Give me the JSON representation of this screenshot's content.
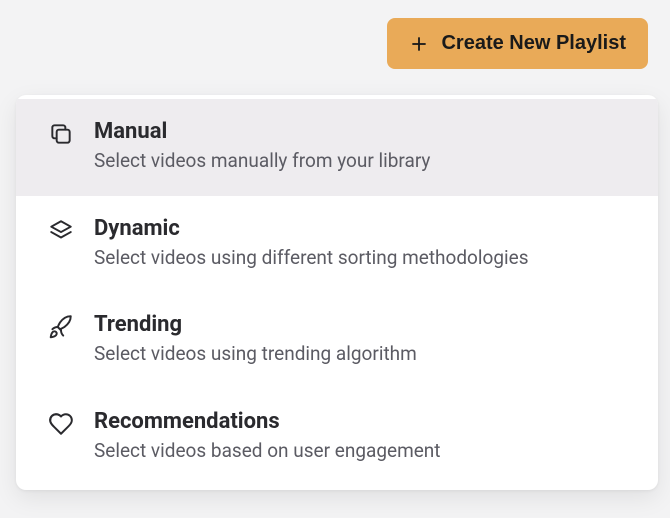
{
  "header": {
    "create_button": "Create New Playlist"
  },
  "menu": {
    "items": [
      {
        "title": "Manual",
        "description": "Select videos manually from your library"
      },
      {
        "title": "Dynamic",
        "description": "Select videos using different sorting methodologies"
      },
      {
        "title": "Trending",
        "description": "Select videos using trending algorithm"
      },
      {
        "title": "Recommendations",
        "description": "Select videos based on user engagement"
      }
    ]
  }
}
